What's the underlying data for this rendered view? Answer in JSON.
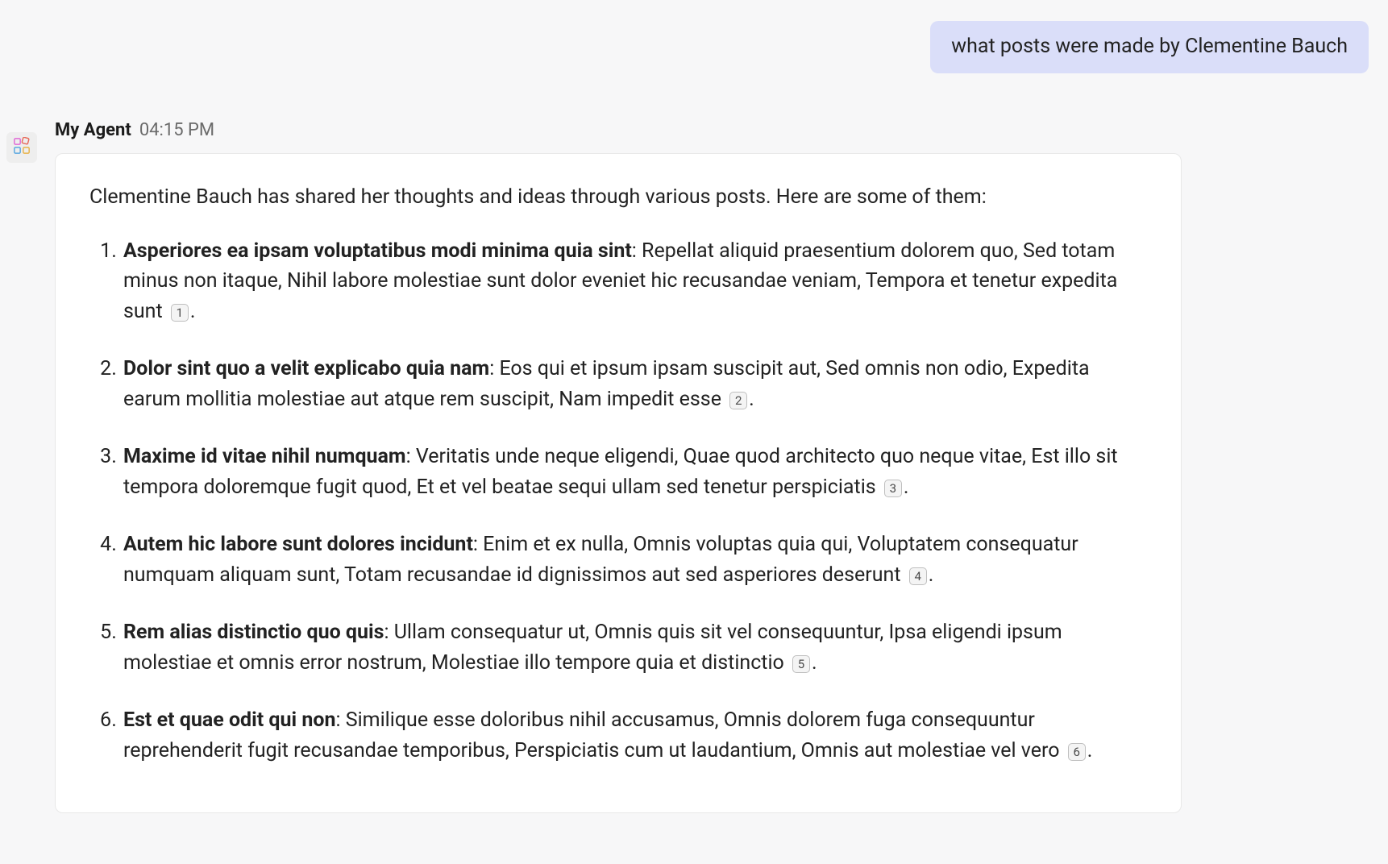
{
  "user_message": {
    "text": "what posts were made by Clementine Bauch"
  },
  "agent": {
    "name": "My Agent",
    "timestamp": "04:15 PM",
    "intro": "Clementine Bauch has shared her thoughts and ideas through various posts. Here are some of them:",
    "posts": [
      {
        "title": "Asperiores ea ipsam voluptatibus modi minima quia sint",
        "body": ": Repellat aliquid praesentium dolorem quo, Sed totam minus non itaque, Nihil labore molestiae sunt dolor eveniet hic recusandae veniam, Tempora et tenetur expedita sunt",
        "ref": "1"
      },
      {
        "title": "Dolor sint quo a velit explicabo quia nam",
        "body": ": Eos qui et ipsum ipsam suscipit aut, Sed omnis non odio, Expedita earum mollitia molestiae aut atque rem suscipit, Nam impedit esse",
        "ref": "2"
      },
      {
        "title": "Maxime id vitae nihil numquam",
        "body": ": Veritatis unde neque eligendi, Quae quod architecto quo neque vitae, Est illo sit tempora doloremque fugit quod, Et et vel beatae sequi ullam sed tenetur perspiciatis",
        "ref": "3"
      },
      {
        "title": "Autem hic labore sunt dolores incidunt",
        "body": ": Enim et ex nulla, Omnis voluptas quia qui, Voluptatem consequatur numquam aliquam sunt, Totam recusandae id dignissimos aut sed asperiores deserunt",
        "ref": "4"
      },
      {
        "title": "Rem alias distinctio quo quis",
        "body": ": Ullam consequatur ut, Omnis quis sit vel consequuntur, Ipsa eligendi ipsum molestiae et omnis error nostrum, Molestiae illo tempore quia et distinctio",
        "ref": "5"
      },
      {
        "title": "Est et quae odit qui non",
        "body": ": Similique esse doloribus nihil accusamus, Omnis dolorem fuga consequuntur reprehenderit fugit recusandae temporibus, Perspiciatis cum ut laudantium, Omnis aut molestiae vel vero",
        "ref": "6"
      }
    ]
  },
  "icons": {
    "agent_avatar": "apps-icon"
  }
}
